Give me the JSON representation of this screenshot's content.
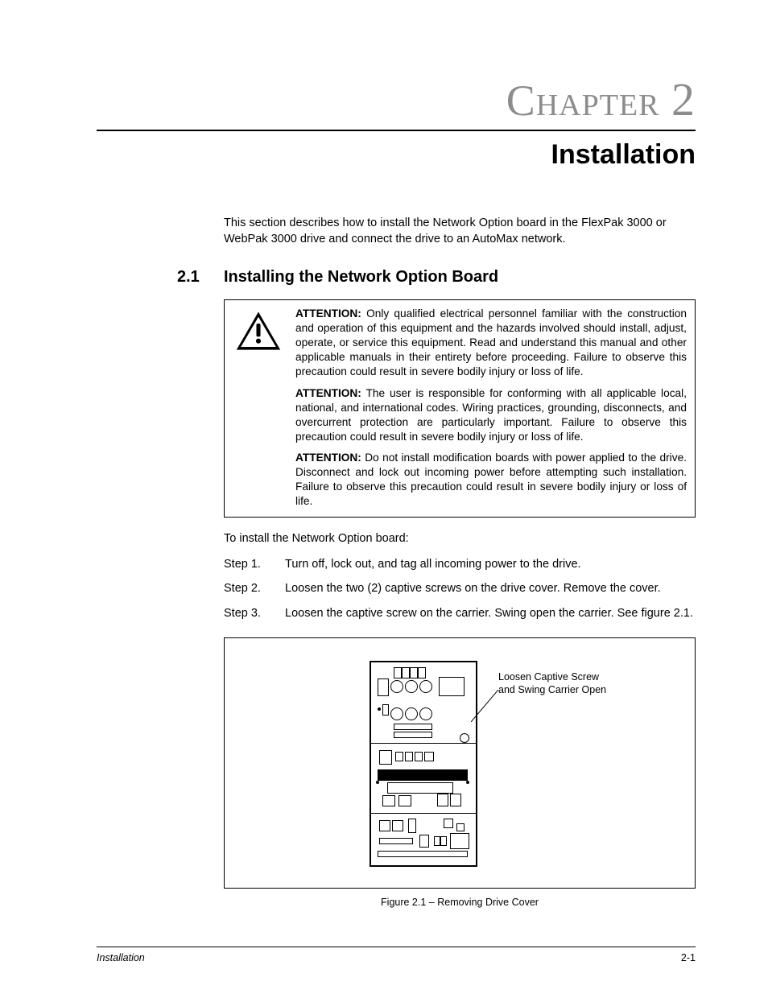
{
  "chapter": {
    "prefix": "Chapter",
    "number": "2"
  },
  "title": "Installation",
  "intro": "This section describes how to install the Network Option board in the FlexPak 3000 or WebPak 3000 drive and connect the drive to an AutoMax network.",
  "section": {
    "number": "2.1",
    "title": "Installing the Network Option Board"
  },
  "attention": {
    "p1_lead": "ATTENTION:",
    "p1": "Only qualified electrical personnel familiar with the construction and operation of this equipment and the hazards involved should install, adjust, operate, or service this equipment. Read and understand this manual and other applicable manuals in their entirety before proceeding. Failure to observe this precaution could result in severe bodily injury or loss of life.",
    "p2_lead": "ATTENTION:",
    "p2": "The user is responsible for conforming with all applicable local, national, and international codes. Wiring practices, grounding, disconnects, and overcurrent protection are particularly important. Failure to observe this precaution could result in severe bodily injury or loss of life.",
    "p3_lead": "ATTENTION:",
    "p3": "Do not install modification boards with power applied to the drive. Disconnect and lock out incoming power before attempting such installation. Failure to observe this precaution could result in severe bodily injury or loss of life."
  },
  "install_lead": "To install the Network Option board:",
  "steps": [
    {
      "label": "Step 1.",
      "text": "Turn off, lock out, and tag all incoming power to the drive."
    },
    {
      "label": "Step 2.",
      "text": "Loosen the two (2) captive screws on the drive cover. Remove the cover."
    },
    {
      "label": "Step 3.",
      "text": "Loosen the captive screw on the carrier. Swing open the carrier. See figure 2.1."
    }
  ],
  "figure": {
    "callout_l1": "Loosen Captive Screw",
    "callout_l2": "and Swing Carrier Open",
    "caption": "Figure 2.1 – Removing Drive Cover"
  },
  "footer": {
    "left": "Installation",
    "right": "2-1"
  }
}
